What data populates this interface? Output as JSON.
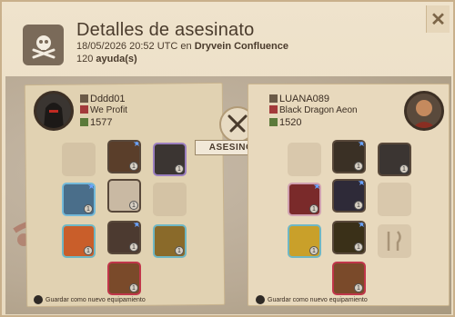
{
  "header": {
    "title": "Detalles de asesinato",
    "datetime": "18/05/2026 20:52 UTC",
    "location_prefix": "en",
    "location": "Dryvein Confluence",
    "assists_count": "120",
    "assists_label": "ayuda(s)",
    "close_glyph": "✕"
  },
  "killer_label": "ASESINO",
  "left": {
    "name": "Dddd01",
    "guild": "We Profit",
    "item_power": "1577",
    "save_label": "Guardar como nuevo equipamiento"
  },
  "right": {
    "name": "LUANA089",
    "guild": "Black Dragon Aeon",
    "item_power": "1520",
    "save_label": "Guardar como nuevo equipamiento"
  },
  "colors": {
    "parchment": "#e8dac0",
    "panel_left": "#e1d2b2",
    "panel_right": "#e8d9bd",
    "text_dark": "#4a3b2c",
    "tier_star": "#6aa3ff"
  }
}
